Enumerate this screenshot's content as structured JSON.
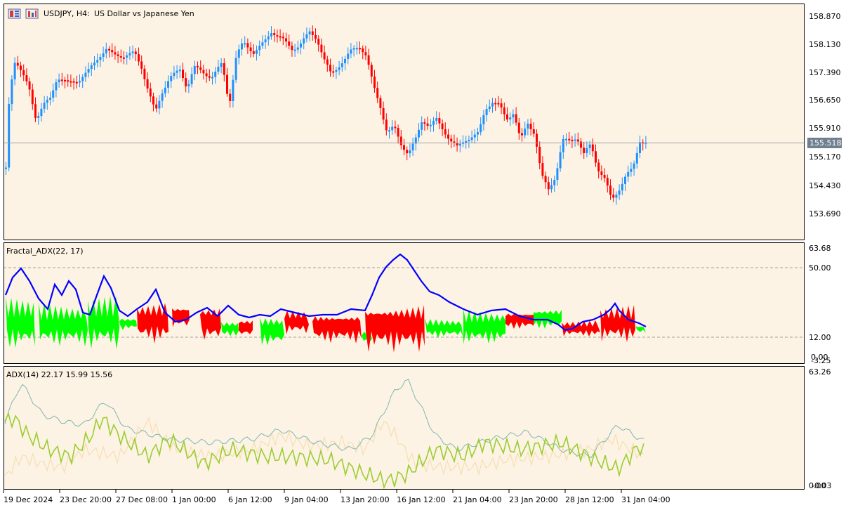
{
  "header": {
    "symbol_label": "USDJPY, H4:",
    "description": "US Dollar vs Japanese Yen"
  },
  "price_pane": {
    "price_levels": [
      "158.870",
      "158.130",
      "157.390",
      "156.650",
      "155.910",
      "155.170",
      "154.430",
      "153.690"
    ],
    "current_price": "155.518",
    "current_price_bg": "#708090"
  },
  "fractal_adx_pane": {
    "title": "Fractal_ADX(22, 17)",
    "levels": [
      "63.68",
      "50.00",
      "12.00",
      "0.00",
      "-3.25"
    ],
    "line_color": "#0000ff",
    "bull_color": "#00ff00",
    "bear_color": "#ff0000"
  },
  "adx_pane": {
    "title": "ADX(14) 22.17 15.99 15.56",
    "levels": [
      "63.26",
      "0.00",
      "-0.03"
    ],
    "adx_color": "#7fb8b0",
    "plus_di_color": "#9acd32",
    "minus_di_color": "#f5deb3"
  },
  "time_axis": {
    "labels": [
      "19 Dec 2024",
      "23 Dec 20:00",
      "27 Dec 08:00",
      "1 Jan 00:00",
      "6 Jan 12:00",
      "9 Jan 04:00",
      "13 Jan 20:00",
      "16 Jan 12:00",
      "21 Jan 04:00",
      "23 Jan 20:00",
      "28 Jan 12:00",
      "31 Jan 04:00"
    ]
  },
  "colors": {
    "background": "#fdf3e4",
    "bull_candle": "#1e90ff",
    "bear_candle": "#ff0000",
    "grid_level": "#a0a0a0"
  },
  "icons": [
    "chart-window-icon",
    "chart-properties-icon"
  ]
}
